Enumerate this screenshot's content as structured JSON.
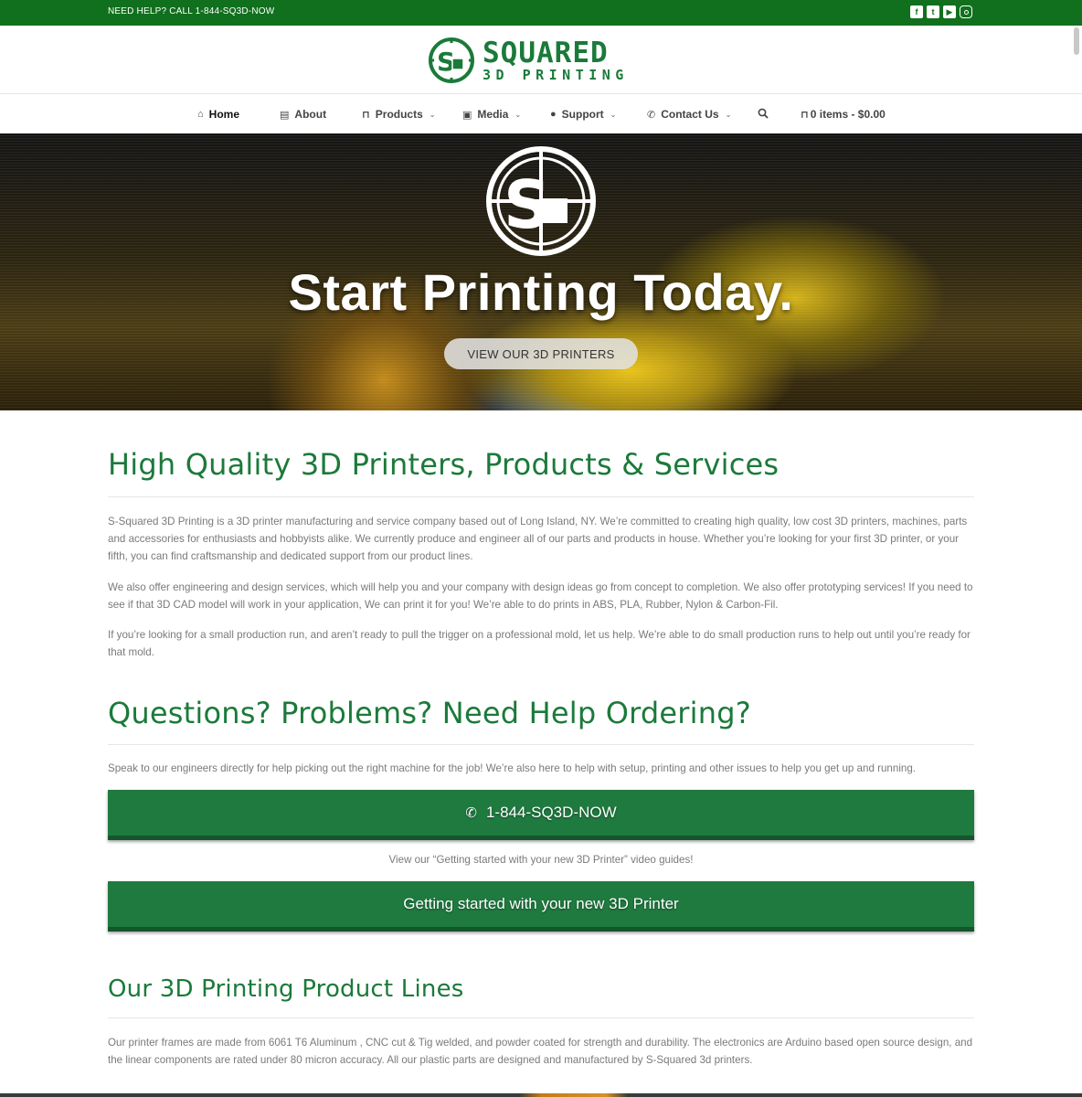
{
  "topbar": {
    "help_text": "NEED HELP? CALL 1-844-SQ3D-NOW",
    "social_icons": [
      "facebook-icon",
      "twitter-icon",
      "youtube-icon",
      "instagram-icon"
    ]
  },
  "brand": {
    "name_line1": "SQUARED",
    "name_line2": "3D PRINTING",
    "color": "#1b7a3a"
  },
  "nav": {
    "items": [
      {
        "label": "Home",
        "icon": "home-icon",
        "active": true
      },
      {
        "label": "About",
        "icon": "book-icon"
      },
      {
        "label": "Products",
        "icon": "cart-icon",
        "dropdown": true
      },
      {
        "label": "Media",
        "icon": "image-icon",
        "dropdown": true
      },
      {
        "label": "Support",
        "icon": "user-icon",
        "dropdown": true
      },
      {
        "label": "Contact Us",
        "icon": "phone-icon",
        "dropdown": true
      }
    ],
    "search_icon": "search-icon",
    "cart_label": "0 items - $0.00"
  },
  "hero": {
    "title": "Start Printing Today.",
    "button_label": "VIEW OUR 3D PRINTERS"
  },
  "main": {
    "heading1": "High Quality 3D Printers, Products & Services",
    "para1": "S-Squared 3D Printing is a 3D printer manufacturing and service company based out of Long Island, NY. We’re committed to creating high quality, low cost 3D printers, machines, parts and accessories for enthusiasts and hobbyists alike. We currently produce and engineer all of our parts and products in house. Whether you’re looking for your first 3D printer, or your fifth, you can find craftsmanship and dedicated support from our product lines.",
    "para2": "We also offer engineering and design services, which will help you and your company with design ideas go from concept to completion. We also offer prototyping services! If you need to see if that 3D CAD model will work in your application, We can print it for you! We’re able to do prints in ABS, PLA, Rubber, Nylon & Carbon-Fil.",
    "para3": "If you’re looking for a small production run, and aren’t ready to pull the trigger on a professional mold, let us help. We’re able to do small production runs to help out until you’re ready for that mold.",
    "heading2": "Questions? Problems? Need Help Ordering?",
    "para4": "Speak to our engineers directly for help picking out the right machine for the job! We’re also here to help with setup, printing and other issues to help you get up and running.",
    "phone_button": "1-844-SQ3D-NOW",
    "video_note": "View our “Getting started with your new 3D Printer” video guides!",
    "guide_button": "Getting started with your new 3D Printer",
    "heading3": "Our 3D Printing Product Lines",
    "para5": "Our printer frames are made from 6061 T6 Aluminum , CNC cut & Tig welded, and powder coated for strength and durability.  The electronics are Arduino based open source design, and the linear components are rated under 80 micron accuracy. All our plastic parts are designed and manufactured by S-Squared 3d printers."
  }
}
